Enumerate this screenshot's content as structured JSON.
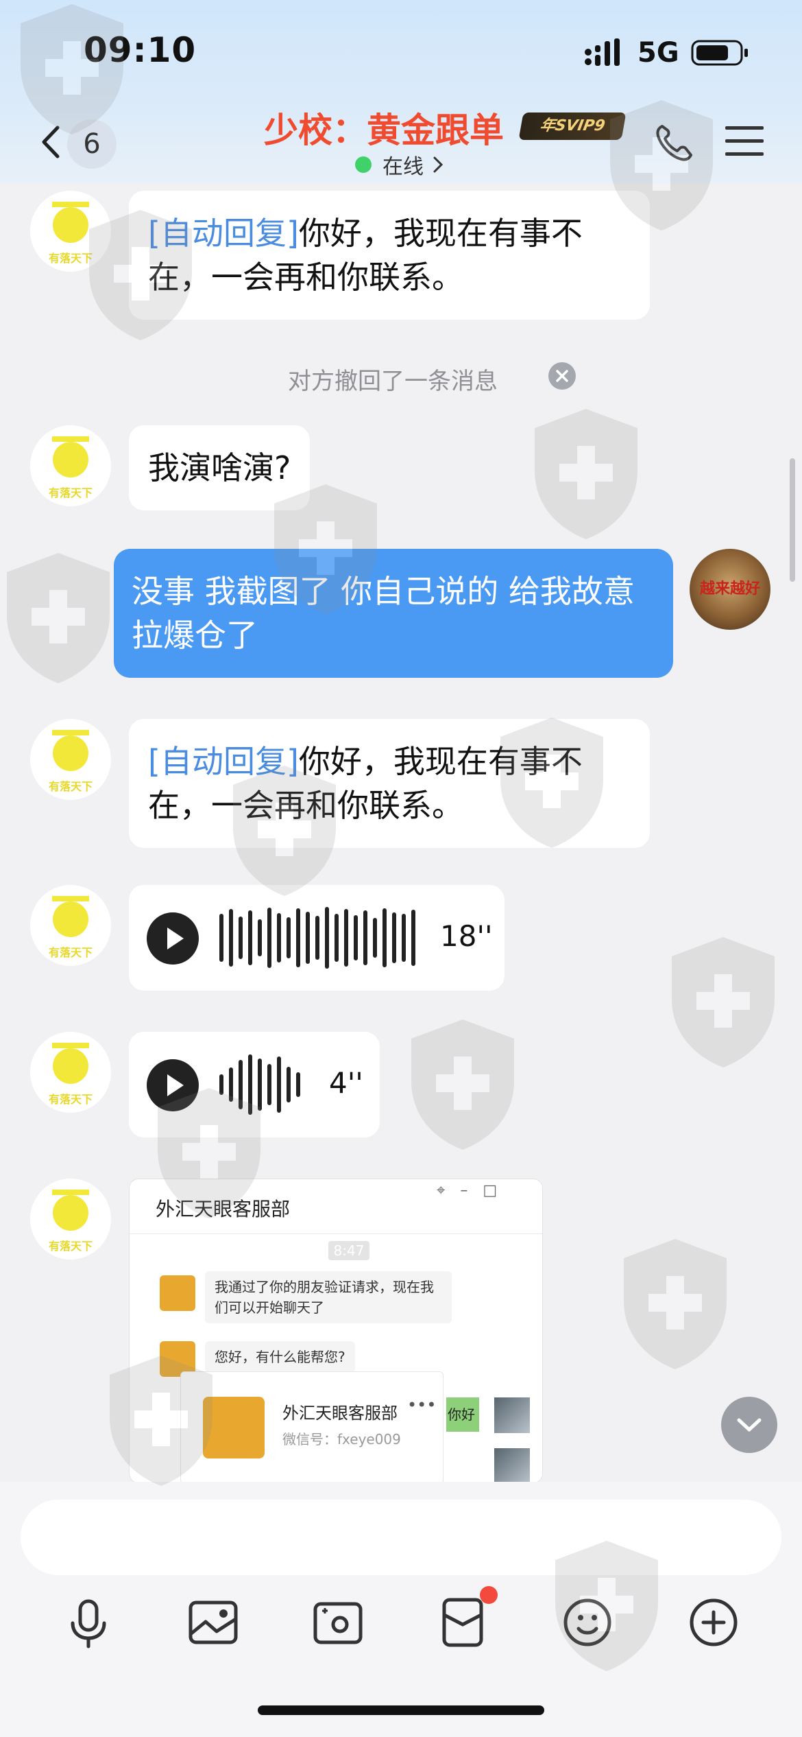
{
  "status_bar": {
    "time": "09:10",
    "network": "5G"
  },
  "header": {
    "unread_count": "6",
    "title": "少校：黄金跟单",
    "badge": "年SVIP9",
    "status": "在线"
  },
  "messages": [
    {
      "type": "auto-reply",
      "tag": "[自动回复]",
      "text": "你好，我现在有事不在，一会再和你联系。"
    },
    {
      "type": "recall-notice",
      "text": "对方撤回了一条消息"
    },
    {
      "type": "incoming",
      "text": "我演啥演?"
    },
    {
      "type": "outgoing",
      "text": "没事 我截图了 你自己说的 给我故意拉爆仓了"
    },
    {
      "type": "auto-reply",
      "tag": "[自动回复]",
      "text": "你好，我现在有事不在，一会再和你联系。"
    },
    {
      "type": "voice",
      "duration": "18''"
    },
    {
      "type": "voice",
      "duration": "4''"
    }
  ],
  "shared_image": {
    "window_title": "外汇天眼客服部",
    "time": "8:47",
    "msg1": "我通过了你的朋友验证请求，现在我们可以开始聊天了",
    "msg2": "您好，有什么能帮您?",
    "card_name": "外汇天眼客服部",
    "card_id": "微信号：fxeye009",
    "green_fragment": "你好"
  },
  "my_avatar_text": "越来越好",
  "avatar_logo_text": "有落天下",
  "icons": [
    "back-chevron-icon",
    "call-icon",
    "menu-icon",
    "microphone-icon",
    "image-icon",
    "camera-icon",
    "red-packet-icon",
    "emoji-icon",
    "plus-icon",
    "chevron-down-icon"
  ],
  "colors": {
    "title": "#f04a2f",
    "outgoing_bubble": "#4a9af4",
    "auto_tag": "#4a8ce0",
    "online": "#3fd26b"
  }
}
